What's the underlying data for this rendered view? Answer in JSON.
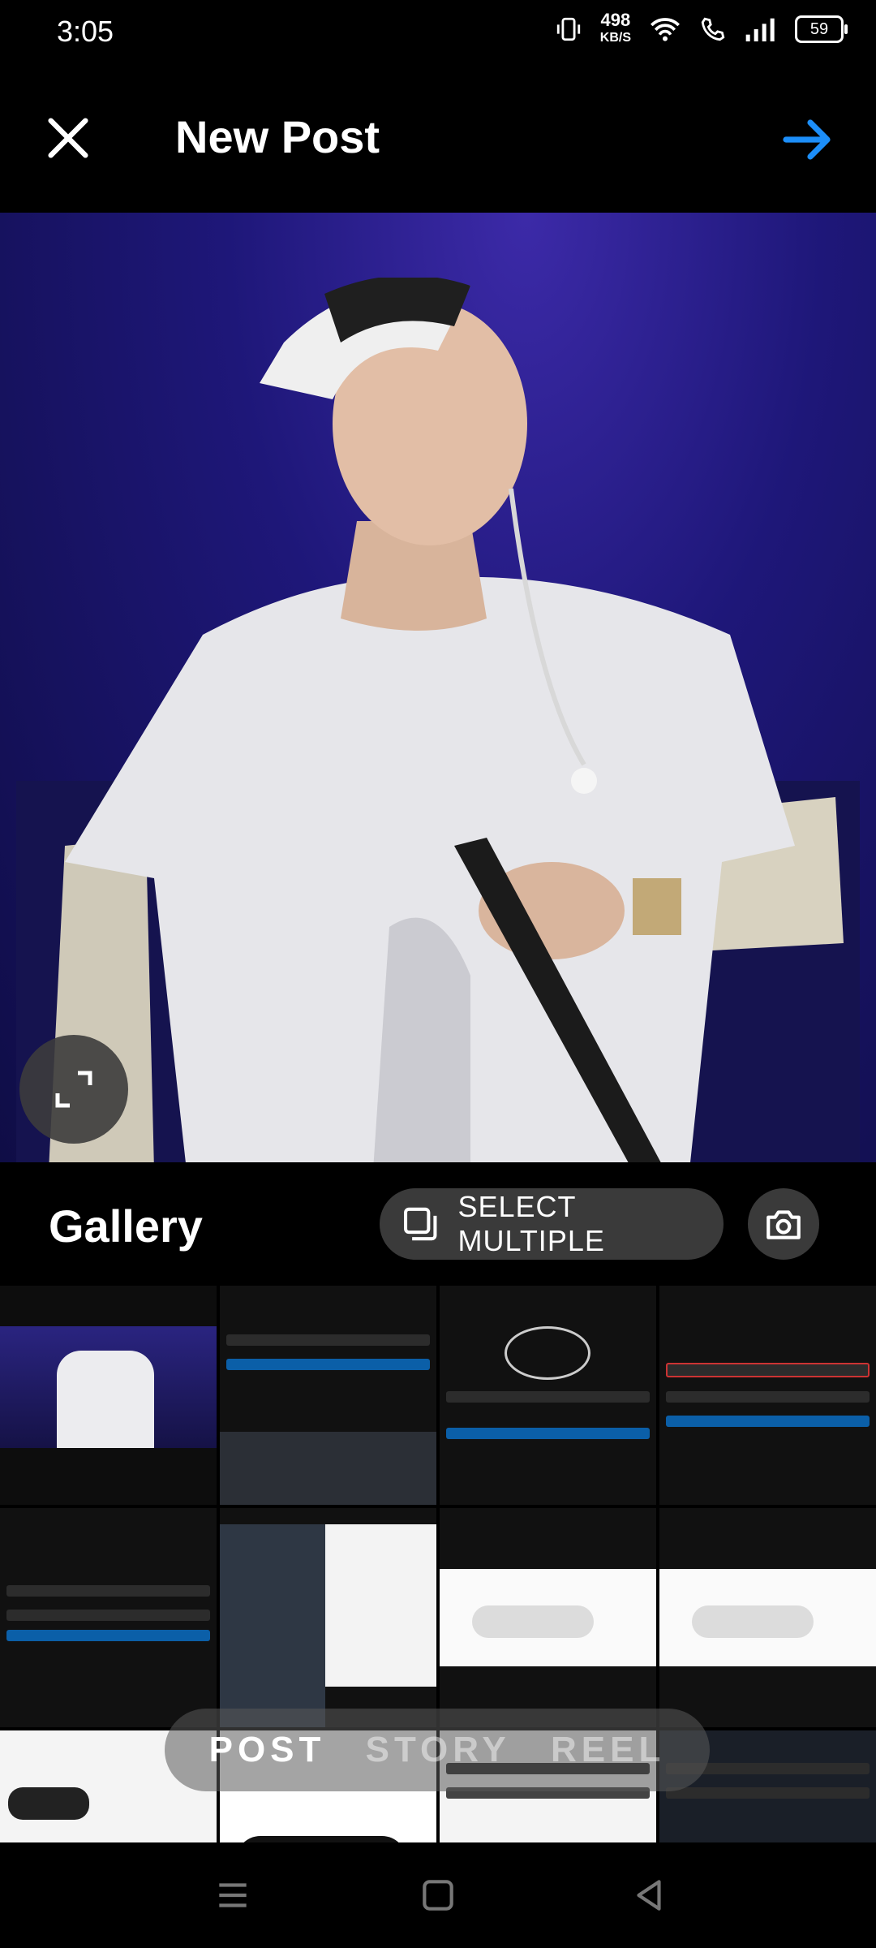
{
  "status_bar": {
    "time": "3:05",
    "net_speed": "498",
    "net_unit": "KB/S",
    "battery": "59"
  },
  "header": {
    "title": "New Post"
  },
  "gallery": {
    "title": "Gallery",
    "select_multiple": "SELECT MULTIPLE"
  },
  "tabs": [
    "POST",
    "STORY",
    "REEL"
  ],
  "colors": {
    "accent": "#1c8ef9",
    "background": "#000000"
  }
}
